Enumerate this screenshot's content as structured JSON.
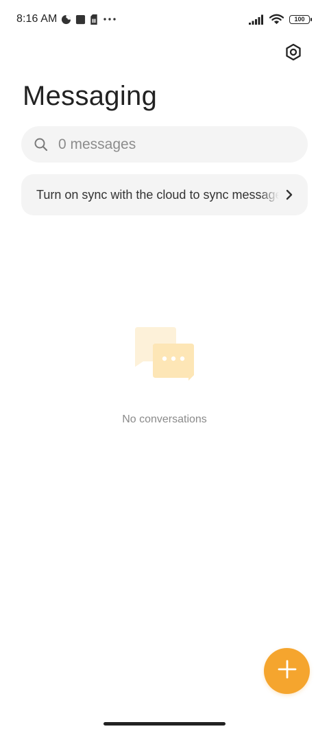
{
  "status_bar": {
    "time": "8:16 AM",
    "notification_icons": [
      "data-saver-icon",
      "notification-square-icon",
      "sim-card-icon",
      "more-dots-icon"
    ],
    "signal_icon": "signal-bars-icon",
    "wifi_icon": "wifi-icon",
    "battery_level": "100"
  },
  "header": {
    "title": "Messaging",
    "settings_icon": "settings-hexagon-icon"
  },
  "search": {
    "placeholder": "0 messages",
    "value": ""
  },
  "sync_banner": {
    "text": "Turn on sync with the cloud to sync messages"
  },
  "empty_state": {
    "icon": "chat-bubbles-icon",
    "text": "No conversations"
  },
  "fab": {
    "icon": "plus-icon"
  },
  "colors": {
    "accent": "#f5a52e",
    "background": "#ffffff",
    "surface": "#f4f4f4",
    "illustration_light": "#fdf1d9",
    "illustration_dark": "#fde6b6"
  }
}
